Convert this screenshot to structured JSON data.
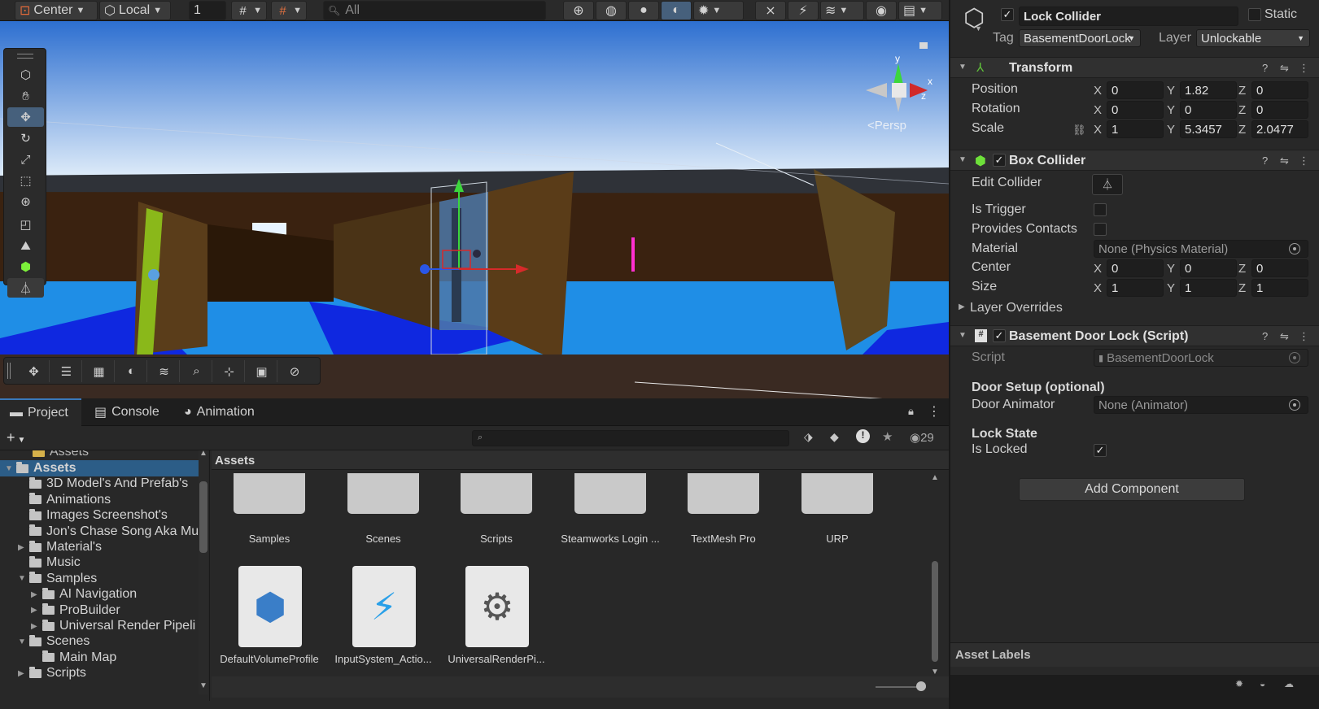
{
  "toolbar": {
    "pivot_label": "Center",
    "space_label": "Local",
    "grid_value": "1",
    "search_placeholder": "All"
  },
  "scene": {
    "gizmo_label": "Persp",
    "axis_x": "x",
    "axis_y": "y",
    "axis_z": "z"
  },
  "bottom_tabs": [
    "Project",
    "Console",
    "Animation"
  ],
  "project": {
    "hidden_count": "29",
    "breadcrumb": "Assets",
    "scrolled_item": "Assets",
    "tree": [
      {
        "label": "Assets",
        "depth": 0,
        "expanded": true
      },
      {
        "label": "3D Model's And Prefab's",
        "depth": 1
      },
      {
        "label": "Animations",
        "depth": 1
      },
      {
        "label": "Images Screenshot's",
        "depth": 1
      },
      {
        "label": "Jon's Chase Song Aka Mu",
        "depth": 1
      },
      {
        "label": "Material's",
        "depth": 1,
        "collapsed": true
      },
      {
        "label": "Music",
        "depth": 1
      },
      {
        "label": "Samples",
        "depth": 1,
        "expanded": true
      },
      {
        "label": "AI Navigation",
        "depth": 2,
        "collapsed": true
      },
      {
        "label": "ProBuilder",
        "depth": 2,
        "collapsed": true
      },
      {
        "label": "Universal Render Pipeli",
        "depth": 2,
        "collapsed": true
      },
      {
        "label": "Scenes",
        "depth": 1,
        "expanded": true
      },
      {
        "label": "Main Map",
        "depth": 2
      },
      {
        "label": "Scripts",
        "depth": 1,
        "collapsed": true
      }
    ],
    "folders": [
      "Samples",
      "Scenes",
      "Scripts",
      "Steamworks Login ...",
      "TextMesh Pro",
      "URP"
    ],
    "files": [
      "DefaultVolumeProfile",
      "InputSystem_Actio...",
      "UniversalRenderPi..."
    ]
  },
  "inspector": {
    "object_name": "Lock Collider",
    "static_label": "Static",
    "tag_label": "Tag",
    "tag_value": "BasementDoorLock",
    "layer_label": "Layer",
    "layer_value": "Unlockable",
    "transform": {
      "title": "Transform",
      "position_label": "Position",
      "rotation_label": "Rotation",
      "scale_label": "Scale",
      "position": {
        "x": "0",
        "y": "1.82",
        "z": "0"
      },
      "rotation": {
        "x": "0",
        "y": "0",
        "z": "0"
      },
      "scale": {
        "x": "1",
        "y": "5.3457",
        "z": "2.0477"
      }
    },
    "box_collider": {
      "title": "Box Collider",
      "edit_collider_label": "Edit Collider",
      "is_trigger_label": "Is Trigger",
      "provides_contacts_label": "Provides Contacts",
      "material_label": "Material",
      "material_value": "None (Physics Material)",
      "center_label": "Center",
      "size_label": "Size",
      "center": {
        "x": "0",
        "y": "0",
        "z": "0"
      },
      "size": {
        "x": "1",
        "y": "1",
        "z": "1"
      },
      "layer_overrides_label": "Layer Overrides"
    },
    "script_comp": {
      "title": "Basement Door Lock (Script)",
      "script_label": "Script",
      "script_value": "BasementDoorLock",
      "door_setup_header": "Door Setup (optional)",
      "door_animator_label": "Door Animator",
      "door_animator_value": "None (Animator)",
      "lock_state_header": "Lock State",
      "is_locked_label": "Is Locked",
      "is_locked": true
    },
    "add_component_label": "Add Component",
    "asset_labels": "Asset Labels"
  },
  "axis_letters": {
    "x": "X",
    "y": "Y",
    "z": "Z"
  }
}
